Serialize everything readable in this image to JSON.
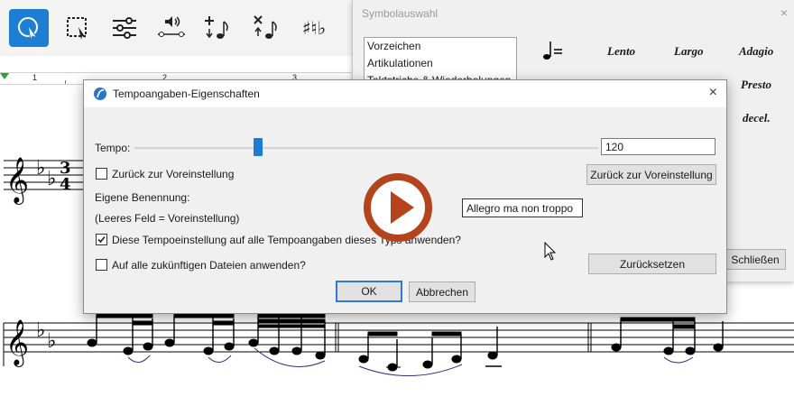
{
  "symbol_palette": {
    "title": "Symbolauswahl",
    "close": "×",
    "categories": [
      "Vorzeichen",
      "Artikulationen",
      "Taktstriche & Wiederholungen"
    ],
    "tempo_marks": [
      "Lento",
      "Largo",
      "Adagio",
      "Presto",
      "decel."
    ],
    "close_button": "Schließen"
  },
  "ruler": {
    "marks": [
      "1",
      "2",
      "3"
    ]
  },
  "dialog": {
    "title": "Tempoangaben-Eigenschaften",
    "close": "×",
    "tempo_label": "Tempo:",
    "tempo_value": "120",
    "tempo_slider_fraction": 0.26,
    "reset_default_checkbox": "Zurück zur Voreinstellung",
    "reset_default_button": "Zurück zur Voreinstellung",
    "custom_name_label": "Eigene Benennung:",
    "empty_field_hint": "(Leeres Feld = Voreinstellung)",
    "custom_name_value": "Allegro ma non troppo",
    "apply_all_checkbox": "Diese Tempoeinstellung auf alle Tempoangaben dieses Typs anwenden?",
    "apply_all_checked": true,
    "future_files_checkbox": "Auf alle zukünftigen Dateien anwenden?",
    "future_files_checked": false,
    "reset_button": "Zurücksetzen",
    "ok_button": "OK",
    "cancel_button": "Abbrechen"
  },
  "score": {
    "time_signature": [
      "3",
      "4"
    ]
  },
  "colors": {
    "accent": "#1f7ad6",
    "play_button": "#b5441c",
    "slur": "#2b2b8a"
  }
}
